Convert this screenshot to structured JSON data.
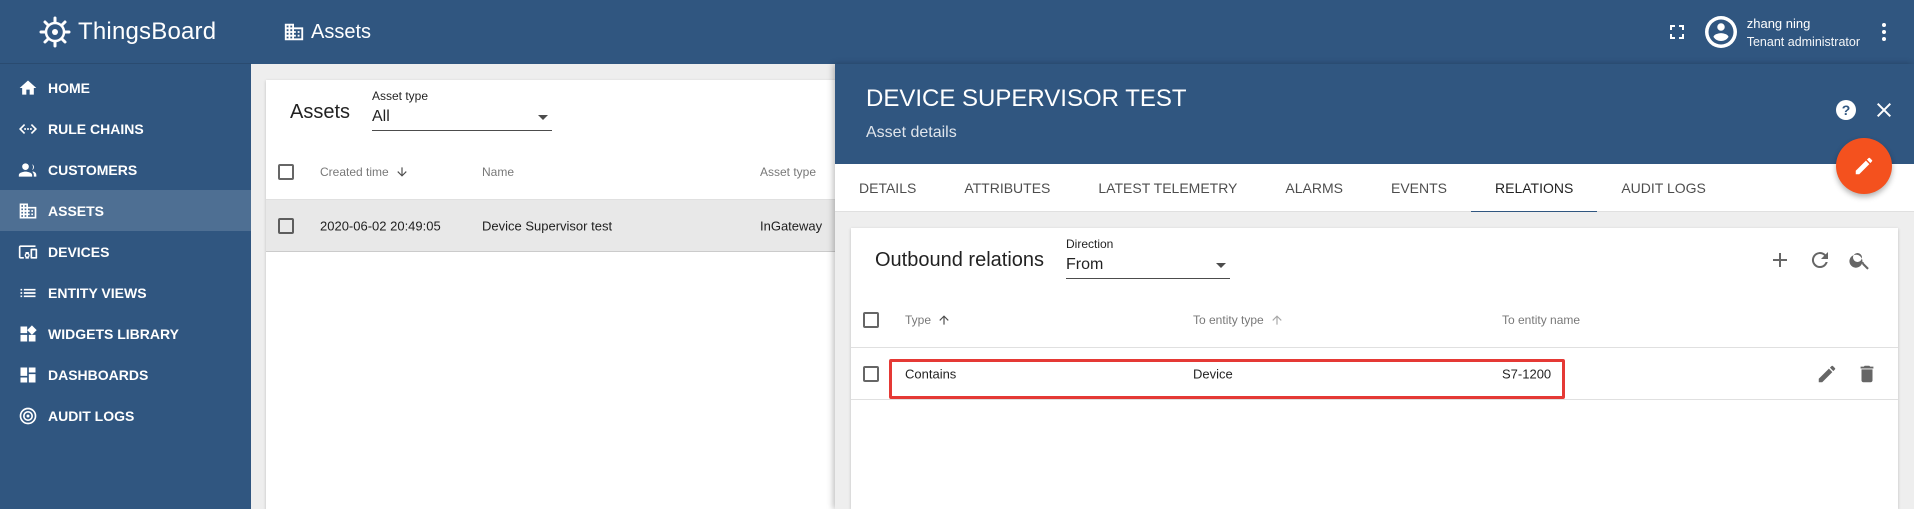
{
  "app": {
    "name": "ThingsBoard"
  },
  "sidebar": {
    "items": [
      {
        "label": "HOME",
        "icon": "home-icon",
        "active": false
      },
      {
        "label": "RULE CHAINS",
        "icon": "rule-chains-icon",
        "active": false
      },
      {
        "label": "CUSTOMERS",
        "icon": "customers-icon",
        "active": false
      },
      {
        "label": "ASSETS",
        "icon": "assets-icon",
        "active": true
      },
      {
        "label": "DEVICES",
        "icon": "devices-icon",
        "active": false
      },
      {
        "label": "ENTITY VIEWS",
        "icon": "entity-views-icon",
        "active": false
      },
      {
        "label": "WIDGETS LIBRARY",
        "icon": "widgets-icon",
        "active": false
      },
      {
        "label": "DASHBOARDS",
        "icon": "dashboards-icon",
        "active": false
      },
      {
        "label": "AUDIT LOGS",
        "icon": "audit-logs-icon",
        "active": false
      }
    ]
  },
  "topbar": {
    "title": "Assets",
    "user_name": "zhang ning",
    "user_role": "Tenant administrator"
  },
  "assets": {
    "title": "Assets",
    "asset_type_label": "Asset type",
    "asset_type_value": "All",
    "columns": {
      "created": "Created time",
      "name": "Name",
      "type": "Asset type"
    },
    "rows": [
      {
        "created": "2020-06-02 20:49:05",
        "name": "Device Supervisor test",
        "type": "InGateway"
      }
    ]
  },
  "details": {
    "title": "DEVICE SUPERVISOR TEST",
    "subtitle": "Asset details",
    "tabs": [
      "DETAILS",
      "ATTRIBUTES",
      "LATEST TELEMETRY",
      "ALARMS",
      "EVENTS",
      "RELATIONS",
      "AUDIT LOGS"
    ],
    "active_tab": "RELATIONS",
    "relations": {
      "title": "Outbound relations",
      "direction_label": "Direction",
      "direction_value": "From",
      "columns": {
        "type": "Type",
        "to_entity_type": "To entity type",
        "to_entity_name": "To entity name"
      },
      "rows": [
        {
          "type": "Contains",
          "to_entity_type": "Device",
          "to_entity_name": "S7-1200"
        }
      ]
    }
  },
  "colors": {
    "primary": "#305680",
    "accent_fab": "#f4511e",
    "highlight": "#e53935"
  }
}
